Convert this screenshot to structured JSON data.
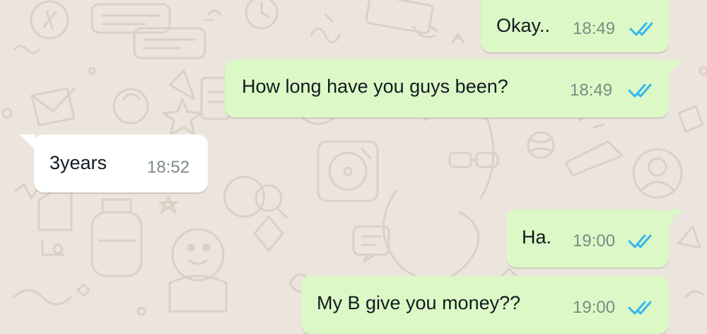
{
  "chat": {
    "messages": [
      {
        "direction": "outgoing",
        "text": "Okay..",
        "time": "18:49",
        "status": "read"
      },
      {
        "direction": "outgoing",
        "text": "How long have you guys been?",
        "time": "18:49",
        "status": "read"
      },
      {
        "direction": "incoming",
        "text": "3years",
        "time": "18:52"
      },
      {
        "direction": "outgoing",
        "text": "Ha.",
        "time": "19:00",
        "status": "read"
      },
      {
        "direction": "outgoing",
        "text": "My B give you money??",
        "time": "19:00",
        "status": "read"
      }
    ]
  },
  "colors": {
    "background": "#ece5dd",
    "outgoing_bubble": "#dcf8c6",
    "incoming_bubble": "#ffffff",
    "read_ticks": "#34b7f1",
    "timestamp": "#7d8b84"
  },
  "icons": {
    "read_receipt": "double-check-icon",
    "wallpaper": "doodle-pattern"
  }
}
